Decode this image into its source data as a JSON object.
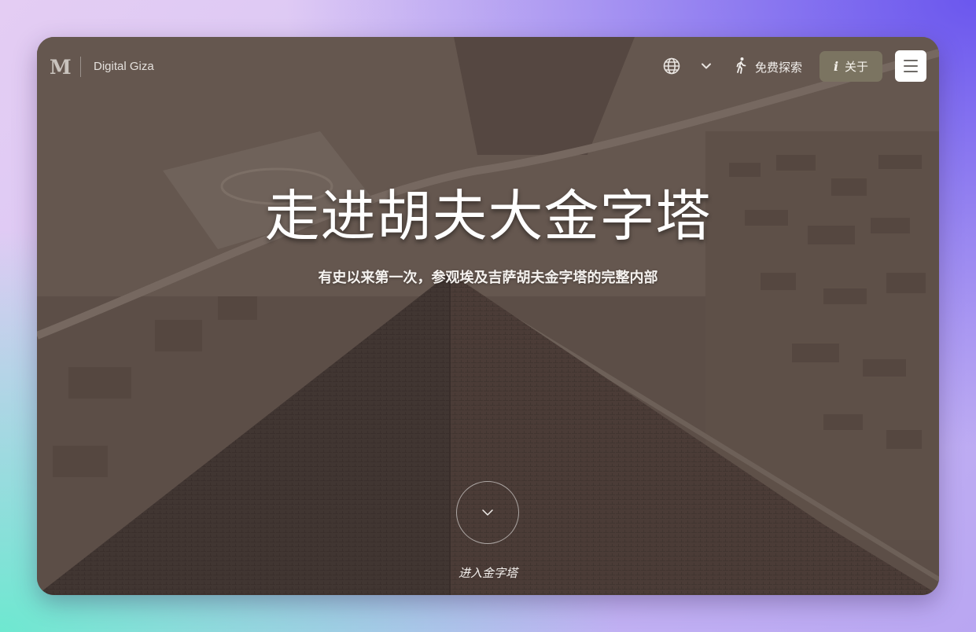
{
  "header": {
    "logo_mark": "M",
    "site_name": "Digital Giza",
    "language_icon": "globe-icon",
    "language_dropdown_icon": "chevron-down-icon",
    "explore_icon": "walking-person-icon",
    "explore_label": "免费探索",
    "about_icon": "info-icon",
    "about_label": "关于",
    "menu_icon": "hamburger-icon"
  },
  "hero": {
    "title": "走进胡夫大金字塔",
    "subtitle": "有史以来第一次，参观埃及吉萨胡夫金字塔的完整内部",
    "enter_icon": "chevron-down-icon",
    "enter_label": "进入金字塔"
  },
  "colors": {
    "about_button_bg": "#7b7461",
    "menu_button_bg": "#ffffff",
    "hero_text": "#ffffff"
  }
}
